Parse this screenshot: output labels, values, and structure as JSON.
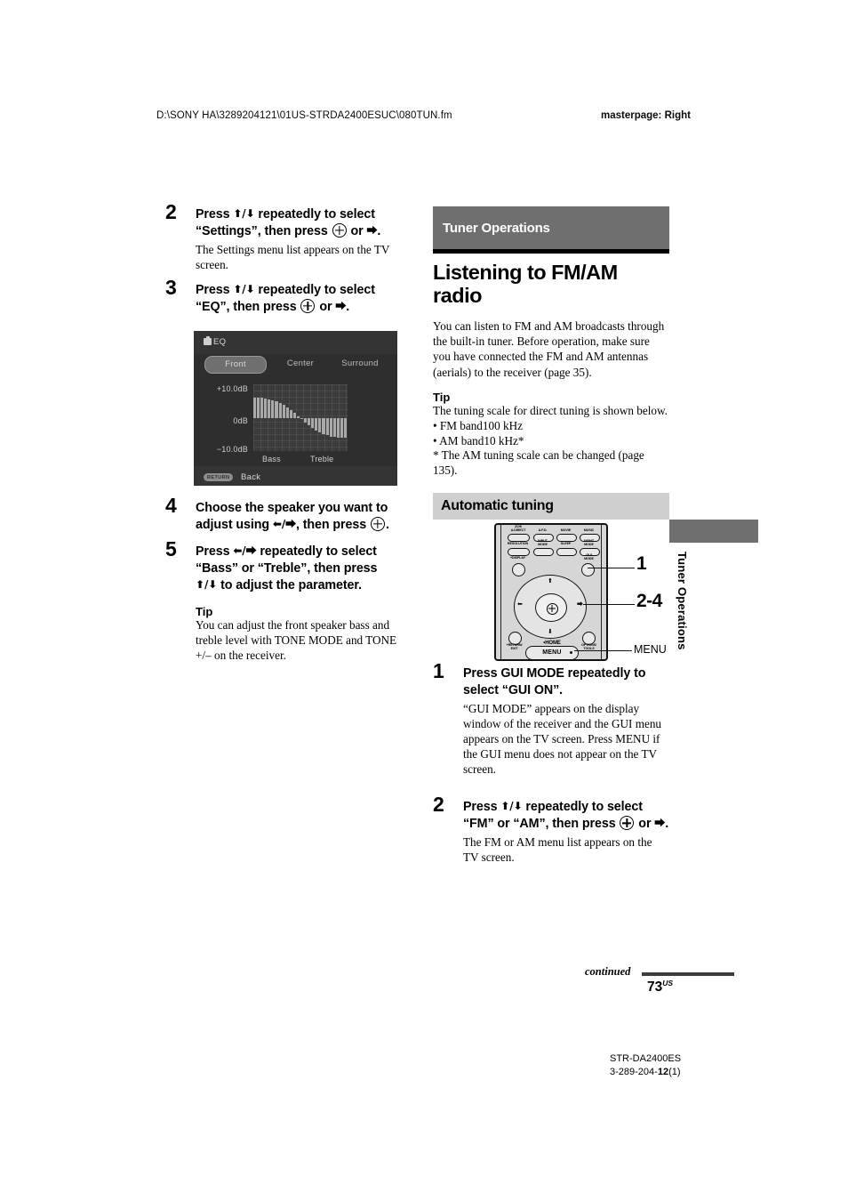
{
  "header": {
    "file_path": "D:\\SONY HA\\3289204121\\01US-STRDA2400ESUC\\080TUN.fm",
    "masterpage": "masterpage: Right"
  },
  "left_column": {
    "steps": [
      {
        "number": "2",
        "title_part1": "Press ",
        "title_arrows": "⬆/⬇",
        "title_part2": " repeatedly to select “Settings”, then press ",
        "title_part3": " or ",
        "title_arrow_end": "⮕",
        "title_end": ".",
        "body": "The Settings menu list appears on the TV screen."
      },
      {
        "number": "3",
        "title_part1": "Press ",
        "title_arrows": "⬆/⬇",
        "title_part2": " repeatedly to select “EQ”, then press ",
        "title_part3": " or ",
        "title_arrow_end": "⮕",
        "title_end": ".",
        "body": ""
      },
      {
        "number": "4",
        "title_part1": "Choose the speaker you want to adjust using ",
        "title_arrows": "⬅/⮕",
        "title_part2": ", then press ",
        "title_part3": "",
        "title_arrow_end": "",
        "title_end": ".",
        "body": ""
      },
      {
        "number": "5",
        "title_part1": "Press ",
        "title_arrows": "⬅/⮕",
        "title_part2": " repeatedly to select “Bass” or “Treble”, then press ",
        "title_part3": "⬆/⬇",
        "title_arrow_end": "",
        "title_end": " to adjust the parameter.",
        "body": ""
      }
    ],
    "tip": {
      "heading": "Tip",
      "body": "You can adjust the front speaker bass and treble level with TONE MODE and TONE +/– on the receiver."
    }
  },
  "eq_screen": {
    "title": "EQ",
    "icon": "toolbox-icon",
    "tabs": [
      "Front",
      "Center",
      "Surround"
    ],
    "selected_tab": "Front",
    "y_labels": [
      "+10.0dB",
      "0dB",
      "−10.0dB"
    ],
    "x_labels": [
      "Bass",
      "Treble"
    ],
    "return_badge": "RETURN",
    "back_label": "Back",
    "colors": {
      "background": "#2e2e2e",
      "bar_background": "#343434",
      "graph_background": "#3b3b3b",
      "bars": "#a9a9a9",
      "selected_tab": "#6f6f6f"
    },
    "curve_values": [
      6.0,
      6.0,
      5.9,
      5.8,
      5.6,
      5.3,
      4.9,
      4.4,
      3.8,
      3.1,
      2.3,
      1.4,
      0.5,
      -0.5,
      -1.4,
      -2.3,
      -3.1,
      -3.8,
      -4.4,
      -4.9,
      -5.3,
      -5.6,
      -5.8,
      -5.9,
      -6.0,
      -6.0
    ]
  },
  "right_column": {
    "section_banner": "Tuner Operations",
    "title": "Listening to FM/AM radio",
    "intro": "You can listen to FM and AM broadcasts through the built-in tuner. Before operation, make sure you have connected the FM and AM antennas (aerials) to the receiver (page 35).",
    "tip": {
      "heading": "Tip",
      "line1": "The tuning scale for direct tuning is shown below.",
      "bullets": [
        "• FM band100 kHz",
        "• AM band10 kHz*"
      ],
      "footnote": "* The AM tuning scale can be changed (page 135)."
    },
    "subsection_banner": "Automatic tuning",
    "steps": [
      {
        "number": "1",
        "title": "Press GUI MODE repeatedly to select “GUI ON”.",
        "body": "“GUI MODE” appears on the display window of the receiver and the GUI menu appears on the TV screen.  Press MENU if the GUI menu does not appear on the TV screen."
      },
      {
        "number": "2",
        "title_part1": "Press ",
        "title_arrows": "⬆/⬇",
        "title_part2": " repeatedly to select “FM” or “AM”, then press ",
        "title_part3": " or ",
        "title_arrow_end": "⮕",
        "title_end": ".",
        "body": "The FM or AM menu list appears on the TV screen."
      }
    ]
  },
  "remote": {
    "buttons_row1": [
      "2CH/\nA.DIRECT",
      "A.F.D.",
      "MOVIE",
      "MUSIC"
    ],
    "buttons_row2": [
      "RESOLUTION",
      "INPUT\nMODE",
      "SLEEP",
      "NIGHT\nMODE"
    ],
    "buttons_row3": [
      "+DISPLAY",
      "GUI\nMODE"
    ],
    "bottom_labels": [
      "+RETURN/\nEXIT",
      "•HOME",
      "OPTIONS/\nTOOLS"
    ],
    "menu_label": "MENU",
    "callouts": [
      {
        "label": "1",
        "target": "gui-mode-button"
      },
      {
        "label": "2-4",
        "target": "dpad"
      },
      {
        "label": "MENU",
        "target": "menu-button"
      }
    ]
  },
  "side_tab": {
    "label": "Tuner Operations"
  },
  "footer": {
    "continued": "continued",
    "page_number": "73",
    "page_suffix": "US",
    "model": "STR-DA2400ES",
    "part_prefix": "3-289-204-",
    "part_bold": "12",
    "part_suffix": "(1)"
  }
}
